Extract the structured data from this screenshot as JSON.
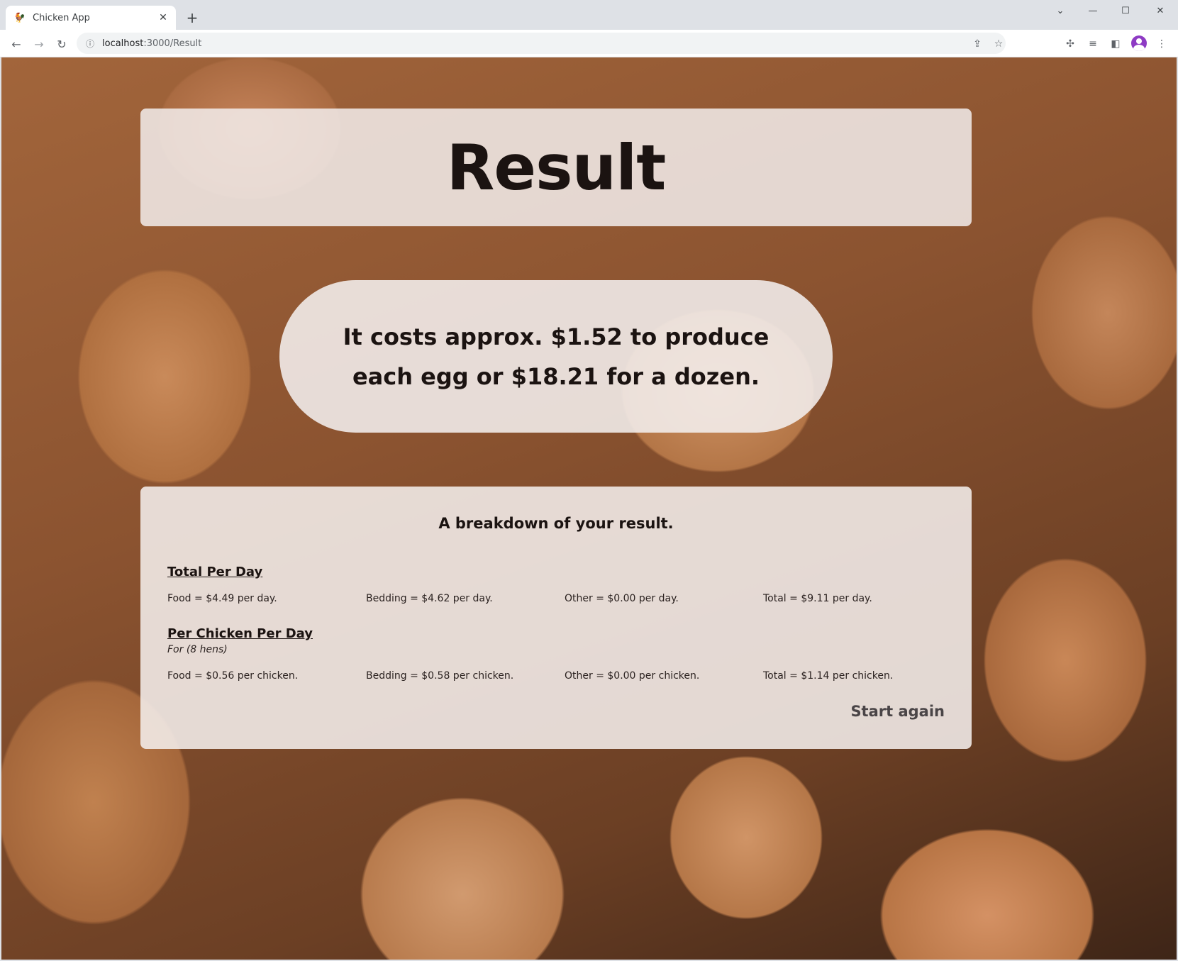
{
  "browser": {
    "tab_title": "Chicken App",
    "favicon": "chicken-icon",
    "url_host": "localhost",
    "url_path": ":3000/Result"
  },
  "page": {
    "title": "Result",
    "cost_statement": "It costs approx. $1.52 to produce each egg or $18.21 for a dozen.",
    "breakdown": {
      "heading": "A breakdown of your result.",
      "total_per_day": {
        "title": "Total Per Day",
        "food": "Food = $4.49 per day.",
        "bedding": "Bedding = $4.62 per day.",
        "other": "Other = $0.00 per day.",
        "total": "Total = $9.11 per day."
      },
      "per_chicken": {
        "title": "Per Chicken Per Day",
        "subtitle": "For (8 hens)",
        "food": "Food = $0.56 per chicken.",
        "bedding": "Bedding = $0.58 per chicken.",
        "other": "Other = $0.00 per chicken.",
        "total": "Total = $1.14 per chicken."
      },
      "start_again": "Start again"
    }
  }
}
